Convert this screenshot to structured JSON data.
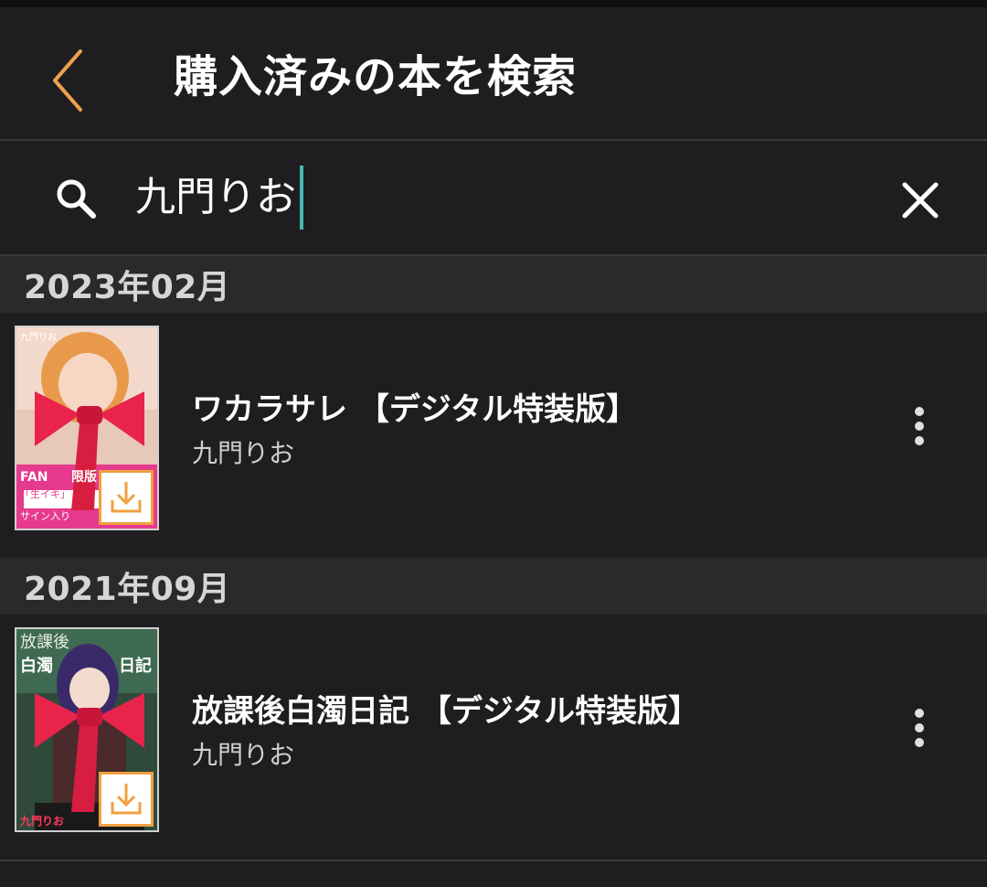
{
  "header": {
    "title": "購入済みの本を検索",
    "back_icon": "chevron-left-icon",
    "accent_color": "#f0a04b"
  },
  "search": {
    "value": "九門りお",
    "search_icon": "search-icon",
    "clear_icon": "close-icon",
    "caret_color": "#4ab6b0"
  },
  "sections": [
    {
      "label": "2023年02月",
      "books": [
        {
          "title": "ワカラサレ 【デジタル特装版】",
          "author": "九門りお",
          "cover_text": [
            "九門りお",
            "FAN",
            "限版",
            "「生イキ」",
            "サイン入り"
          ],
          "badge_icon": "download-icon",
          "more_icon": "more-vertical-icon"
        }
      ]
    },
    {
      "label": "2021年09月",
      "books": [
        {
          "title": "放課後白濁日記 【デジタル特装版】",
          "author": "九門りお",
          "cover_text": [
            "放課後",
            "白濁",
            "日記",
            "九門りお"
          ],
          "badge_icon": "download-icon",
          "more_icon": "more-vertical-icon"
        }
      ]
    }
  ]
}
